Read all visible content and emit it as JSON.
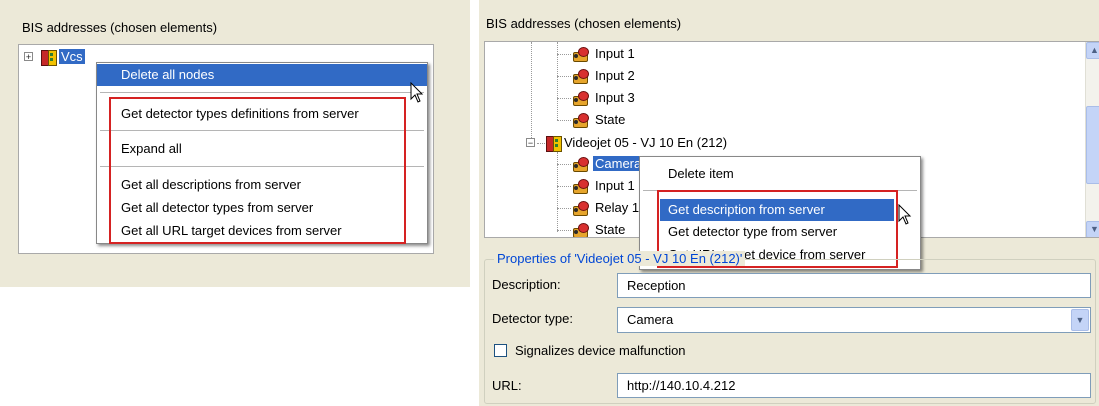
{
  "left": {
    "title": "BIS addresses (chosen elements)",
    "tree_node_label": "Vcs",
    "expander_symbol": "+",
    "context_menu": {
      "items": [
        "Delete all nodes",
        "Get detector types definitions from server",
        "Expand all",
        "Get all descriptions from server",
        "Get all detector types from server",
        "Get all URL target devices from server"
      ],
      "highlighted_index": 0
    }
  },
  "right": {
    "title": "BIS addresses (chosen elements)",
    "tree": {
      "top_items": [
        "Input 1",
        "Input 2",
        "Input 3",
        "State"
      ],
      "device_label": "Videojet 05 - VJ 10 En (212)",
      "device_expander_symbol": "−",
      "children": [
        "Camera",
        "Input 1",
        "Relay 1",
        "State"
      ],
      "selected_child": "Camera"
    },
    "context_menu": {
      "items": [
        "Delete item",
        "Get description from server",
        "Get detector type from server",
        "Get URL target device from server"
      ],
      "highlighted_index": 1
    },
    "properties": {
      "legend": "Properties of 'Videojet 05 - VJ 10 En (212)'",
      "description_label": "Description:",
      "description_value": "Reception",
      "detector_type_label": "Detector type:",
      "detector_type_value": "Camera",
      "malfunction_label": "Signalizes device malfunction",
      "malfunction_checked": false,
      "url_label": "URL:",
      "url_value": "http://140.10.4.212"
    }
  },
  "colors": {
    "window_bg": "#ece9d8",
    "menu_highlight": "#316ac5",
    "annotation_box": "#d52222",
    "group_legend": "#0046d5"
  },
  "icons": {
    "scroll_up": "▲",
    "scroll_down": "▼",
    "dropdown": "▼"
  }
}
